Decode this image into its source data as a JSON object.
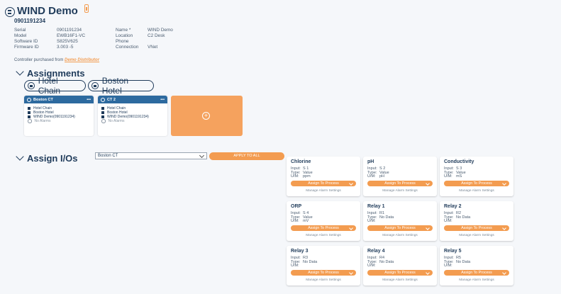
{
  "header": {
    "title": "WIND Demo",
    "serial": "0901191234",
    "fields_left": [
      {
        "label": "Serial",
        "value": "0901191234"
      },
      {
        "label": "Model",
        "value": "EWB16F1-VC"
      },
      {
        "label": "Software ID",
        "value": "S825V625"
      },
      {
        "label": "Firmware ID",
        "value": "3.003 -5"
      }
    ],
    "fields_right": [
      {
        "label": "Name *",
        "value": "WIND Demo"
      },
      {
        "label": "Location",
        "value": "C2 Desk"
      },
      {
        "label": "Phone",
        "value": ""
      },
      {
        "label": "Connection",
        "value": "VNet"
      }
    ],
    "purchased_text": "Controller purchased from",
    "distributor_link": "Demo Distributor"
  },
  "assignments": {
    "title": "Assignments",
    "pills": [
      "Hotel Chain",
      "Boston Hotel"
    ],
    "cards": [
      {
        "name": "Boston CT",
        "more": "•••",
        "chain": "Hotel Chain",
        "hotel": "Boston Hotel",
        "controller": "WIND Demo(0901191234)",
        "alarms": "No Alarms"
      },
      {
        "name": "CT 2",
        "more": "•••",
        "chain": "Hotel Chain",
        "hotel": "Boston Hotel",
        "controller": "WIND Demo(0901191234)",
        "alarms": "No Alarms"
      }
    ],
    "add_symbol": "+"
  },
  "assign_ios": {
    "title": "Assign I/Os",
    "select_value": "Boston CT",
    "apply_label": "APPLY TO ALL",
    "labels": {
      "input": "Input:",
      "type": "Type:",
      "um": "U/M:"
    },
    "assign_label": "Assign To Process",
    "alarm_label": "Manage Alarm Settings",
    "cards": [
      {
        "name": "Chlorine",
        "input": "S 1",
        "type": "Value",
        "um": "ppm"
      },
      {
        "name": "pH",
        "input": "S 2",
        "type": "Value",
        "um": "pH"
      },
      {
        "name": "Conductivity",
        "input": "S 3",
        "type": "Value",
        "um": "mS"
      },
      {
        "name": "ORP",
        "input": "S 4",
        "type": "Value",
        "um": "mV"
      },
      {
        "name": "Relay 1",
        "input": "R1",
        "type": "No Data",
        "um": ""
      },
      {
        "name": "Relay 2",
        "input": "R2",
        "type": "No Data",
        "um": ""
      },
      {
        "name": "Relay 3",
        "input": "R3",
        "type": "No Data",
        "um": ""
      },
      {
        "name": "Relay 4",
        "input": "R4",
        "type": "No Data",
        "um": ""
      },
      {
        "name": "Relay 5",
        "input": "R5",
        "type": "No Data",
        "um": ""
      }
    ]
  }
}
